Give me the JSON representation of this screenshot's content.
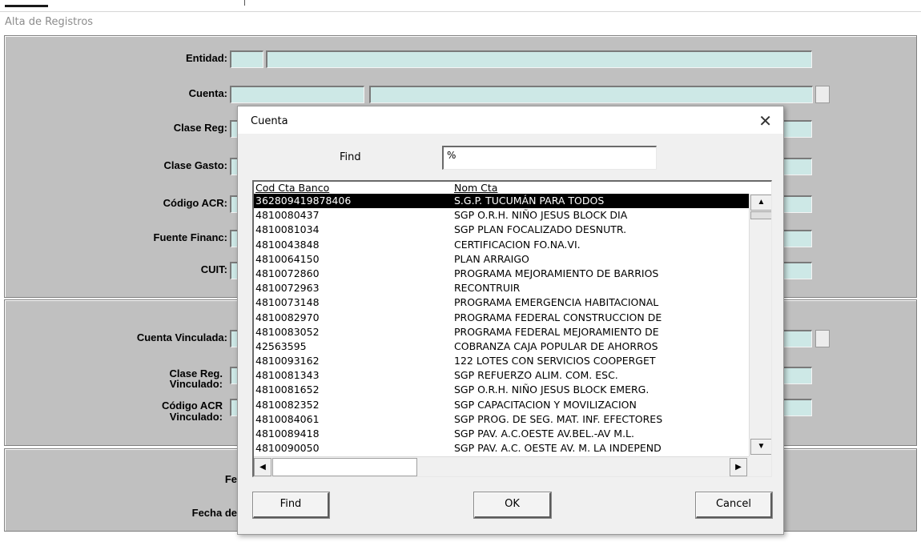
{
  "window": {
    "title": "Alta de Registros"
  },
  "form": {
    "entidad": "Entidad:",
    "cuenta": "Cuenta:",
    "clase_reg": "Clase Reg:",
    "clase_gasto": "Clase Gasto:",
    "codigo_acr": "Código ACR:",
    "fuente_financ": "Fuente Financ:",
    "cuit": "CUIT:",
    "cuenta_vinculada": "Cuenta Vinculada:",
    "clase_reg_vinc_1": "Clase Reg.",
    "clase_reg_vinc_2": "Vinculado:",
    "codigo_acr_vinc_1": "Código ACR",
    "codigo_acr_vinc_2": "Vinculado:",
    "fecha_1": "Fe",
    "fecha_2": "Fecha de"
  },
  "dialog": {
    "title": "Cuenta",
    "close_glyph": "✕",
    "find_label": "Find",
    "find_value": "%",
    "columns": [
      "Cod Cta Banco",
      "Nom Cta"
    ],
    "rows": [
      [
        "362809419878406",
        "S.G.P. TUCUMÁN PARA TODOS"
      ],
      [
        "4810080437",
        "SGP O.R.H. NIÑO JESUS BLOCK DIA"
      ],
      [
        "4810081034",
        "SGP PLAN FOCALIZADO DESNUTR."
      ],
      [
        "4810043848",
        "CERTIFICACION FO.NA.VI."
      ],
      [
        "4810064150",
        "PLAN ARRAIGO"
      ],
      [
        "4810072860",
        "PROGRAMA MEJORAMIENTO DE BARRIOS"
      ],
      [
        "4810072963",
        "RECONTRUIR"
      ],
      [
        "4810073148",
        "PROGRAMA EMERGENCIA HABITACIONAL"
      ],
      [
        "4810082970",
        "PROGRAMA FEDERAL CONSTRUCCION DE"
      ],
      [
        "4810083052",
        "PROGRAMA FEDERAL MEJORAMIENTO DE"
      ],
      [
        "42563595",
        "COBRANZA CAJA POPULAR DE AHORROS"
      ],
      [
        "4810093162",
        "122 LOTES CON SERVICIOS COOPERGET"
      ],
      [
        "4810081343",
        "SGP REFUERZO ALIM. COM. ESC."
      ],
      [
        "4810081652",
        "SGP O.R.H. NIÑO JESUS BLOCK EMERG."
      ],
      [
        "4810082352",
        "SGP CAPACITACION Y MOVILIZACION"
      ],
      [
        "4810084061",
        "SGP PROG. DE SEG. MAT. INF. EFECTORES"
      ],
      [
        "4810089418",
        "SGP PAV. A.C.OESTE AV.BEL.-AV M.L."
      ],
      [
        "4810090050",
        "SGP PAV. A.C. OESTE AV. M. LA INDEPEND"
      ]
    ],
    "selected_row": 0,
    "buttons": {
      "find": "Find",
      "ok": "OK",
      "cancel": "Cancel"
    },
    "scroll_glyphs": {
      "up": "▲",
      "down": "▼",
      "left": "◀",
      "right": "▶"
    }
  }
}
